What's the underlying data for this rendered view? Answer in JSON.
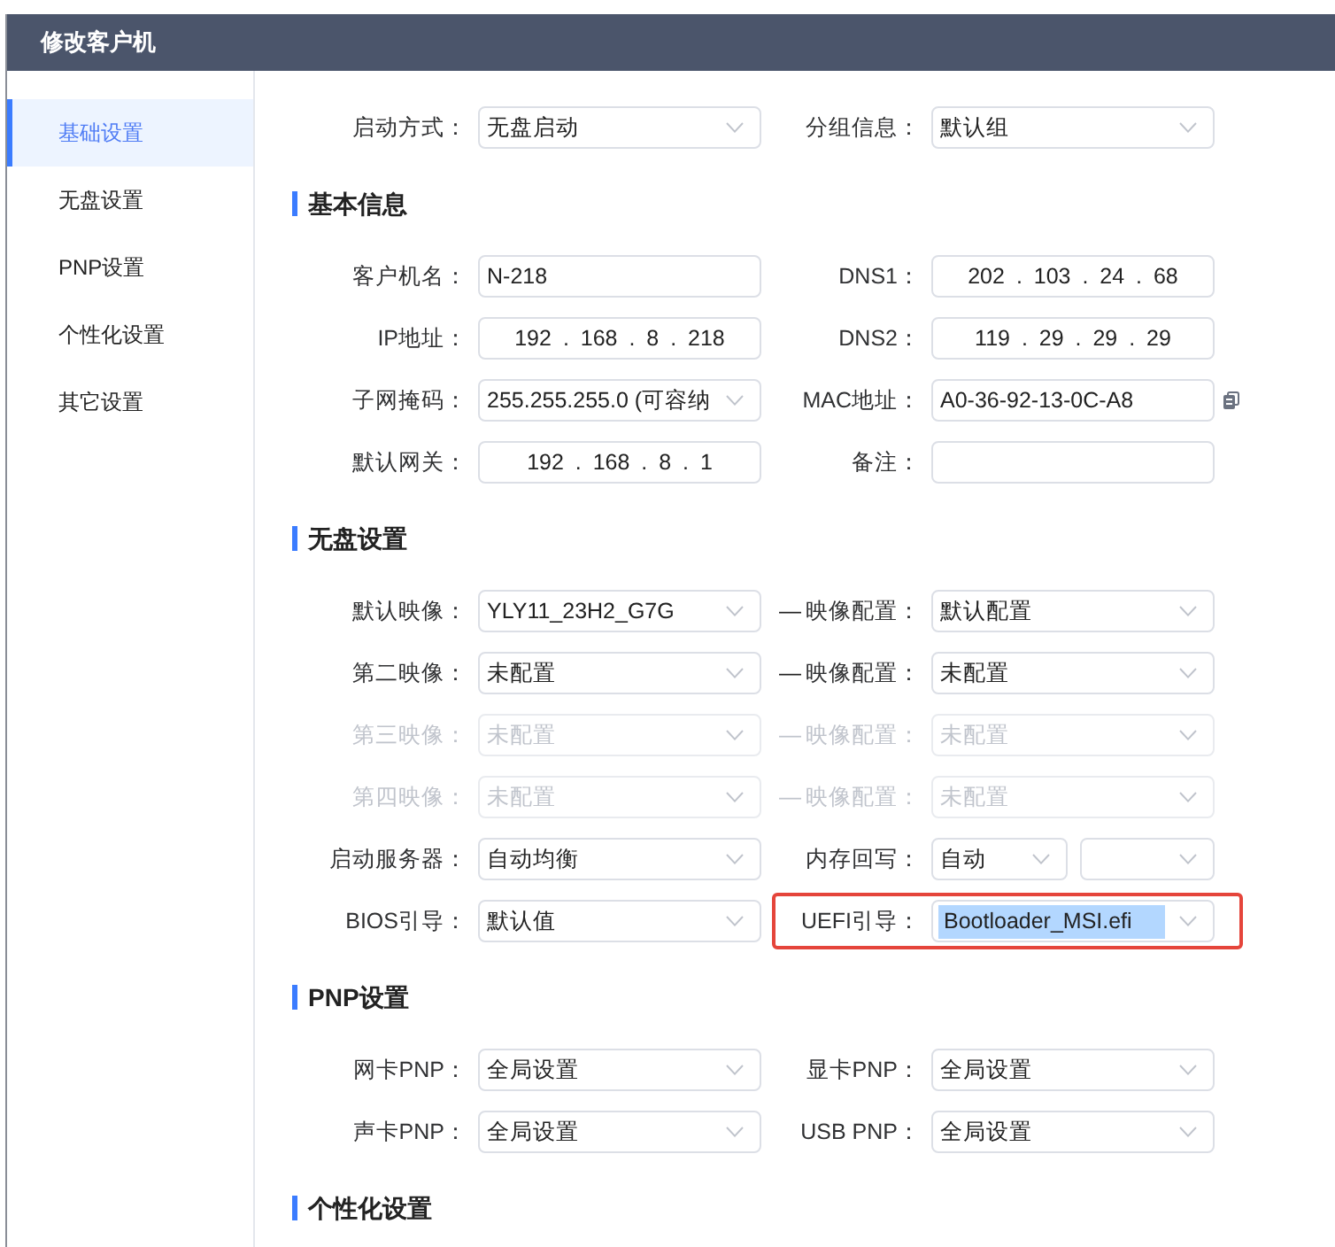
{
  "window": {
    "title": "修改客户机"
  },
  "sidebar": {
    "items": [
      {
        "label": "基础设置",
        "selected": true
      },
      {
        "label": "无盘设置",
        "selected": false
      },
      {
        "label": "PNP设置",
        "selected": false
      },
      {
        "label": "个性化设置",
        "selected": false
      },
      {
        "label": "其它设置",
        "selected": false
      }
    ]
  },
  "top_row": {
    "left": {
      "label": "启动方式：",
      "kind": "select",
      "value": "无盘启动",
      "disabled": false
    },
    "right": {
      "label": "分组信息：",
      "kind": "select",
      "value": "默认组",
      "disabled": false
    }
  },
  "sections": [
    {
      "title": "基本信息",
      "rows": [
        {
          "left": {
            "label": "客户机名：",
            "kind": "text",
            "value": "N-218",
            "disabled": false
          },
          "right": {
            "label": "DNS1：",
            "kind": "ip",
            "value": "202 . 103 . 24 . 68",
            "disabled": false
          }
        },
        {
          "left": {
            "label": "IP地址：",
            "kind": "ip",
            "value": "192 . 168 . 8 . 218",
            "disabled": false
          },
          "right": {
            "label": "DNS2：",
            "kind": "ip",
            "value": "119 . 29 . 29 . 29",
            "disabled": false
          }
        },
        {
          "left": {
            "label": "子网掩码：",
            "kind": "select",
            "value": "255.255.255.0 (可容纳",
            "disabled": false
          },
          "right": {
            "label": "MAC地址：",
            "kind": "text",
            "value": "A0-36-92-13-0C-A8",
            "disabled": false,
            "copyable": true
          }
        },
        {
          "left": {
            "label": "默认网关：",
            "kind": "ip",
            "value": "192 . 168 . 8 . 1",
            "disabled": false
          },
          "right": {
            "label": "备注：",
            "kind": "text",
            "disabled": false
          }
        }
      ]
    },
    {
      "title": "无盘设置",
      "rows": [
        {
          "left": {
            "label": "默认映像：",
            "kind": "select",
            "value": "YLY11_23H2_G7G",
            "disabled": false
          },
          "right": {
            "prefix": "—",
            "label": "映像配置：",
            "kind": "select",
            "value": "默认配置",
            "disabled": false
          }
        },
        {
          "left": {
            "label": "第二映像：",
            "kind": "select",
            "value": "未配置",
            "disabled": false
          },
          "right": {
            "prefix": "—",
            "label": "映像配置：",
            "kind": "select",
            "value": "未配置",
            "disabled": false
          }
        },
        {
          "left": {
            "label": "第三映像：",
            "kind": "select",
            "value": "未配置",
            "disabled": true
          },
          "right": {
            "prefix": "—",
            "label": "映像配置：",
            "kind": "select",
            "value": "未配置",
            "disabled": true
          }
        },
        {
          "left": {
            "label": "第四映像：",
            "kind": "select",
            "value": "未配置",
            "disabled": true
          },
          "right": {
            "prefix": "—",
            "label": "映像配置：",
            "kind": "select",
            "value": "未配置",
            "disabled": true
          }
        },
        {
          "left": {
            "label": "启动服务器：",
            "kind": "select",
            "value": "自动均衡",
            "disabled": false
          },
          "right": {
            "label": "内存回写：",
            "kind": "select_pair",
            "value": "自动",
            "disabled": false
          }
        },
        {
          "left": {
            "label": "BIOS引导：",
            "kind": "select",
            "value": "默认值",
            "disabled": false
          },
          "right": {
            "label": "UEFI引导：",
            "kind": "select",
            "value": "Bootloader_MSI.efi",
            "disabled": false,
            "highlighted": true,
            "value_selected": true
          }
        }
      ]
    },
    {
      "title": "PNP设置",
      "rows": [
        {
          "left": {
            "label": "网卡PNP：",
            "kind": "select",
            "value": "全局设置",
            "disabled": false
          },
          "right": {
            "label": "显卡PNP：",
            "kind": "select",
            "value": "全局设置",
            "disabled": false
          }
        },
        {
          "left": {
            "label": "声卡PNP：",
            "kind": "select",
            "value": "全局设置",
            "disabled": false
          },
          "right": {
            "label": "USB PNP：",
            "kind": "select",
            "value": "全局设置",
            "disabled": false
          }
        }
      ]
    },
    {
      "title": "个性化设置"
    }
  ]
}
